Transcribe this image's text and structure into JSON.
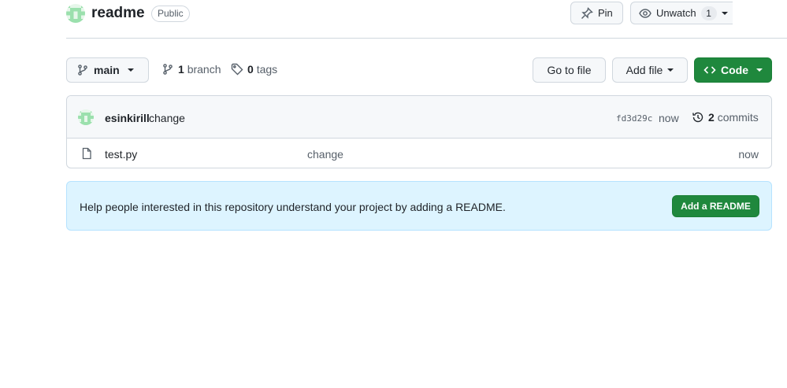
{
  "repo": {
    "name": "readme",
    "visibility": "Public",
    "avatar_icon": "identicon-green"
  },
  "header_actions": {
    "pin_label": "Pin",
    "unwatch_label": "Unwatch",
    "watch_count": "1"
  },
  "toolbar": {
    "branch_name": "main",
    "branch_count": "1",
    "branch_word": "branch",
    "tag_count": "0",
    "tag_word": "tags",
    "go_to_file": "Go to file",
    "add_file": "Add file",
    "code": "Code"
  },
  "latest_commit": {
    "author": "esinkirill",
    "message": "change",
    "sha": "fd3d29c",
    "time": "now",
    "commits_count": "2",
    "commits_word": "commits"
  },
  "files": [
    {
      "name": "test.py",
      "commit_message": "change",
      "age": "now",
      "icon": "file-icon"
    }
  ],
  "readme_prompt": {
    "text": "Help people interested in this repository understand your project by adding a README.",
    "button": "Add a README"
  },
  "colors": {
    "primary_green": "#1f883d",
    "banner_bg": "#ddf4ff",
    "border": "#d0d7de"
  }
}
